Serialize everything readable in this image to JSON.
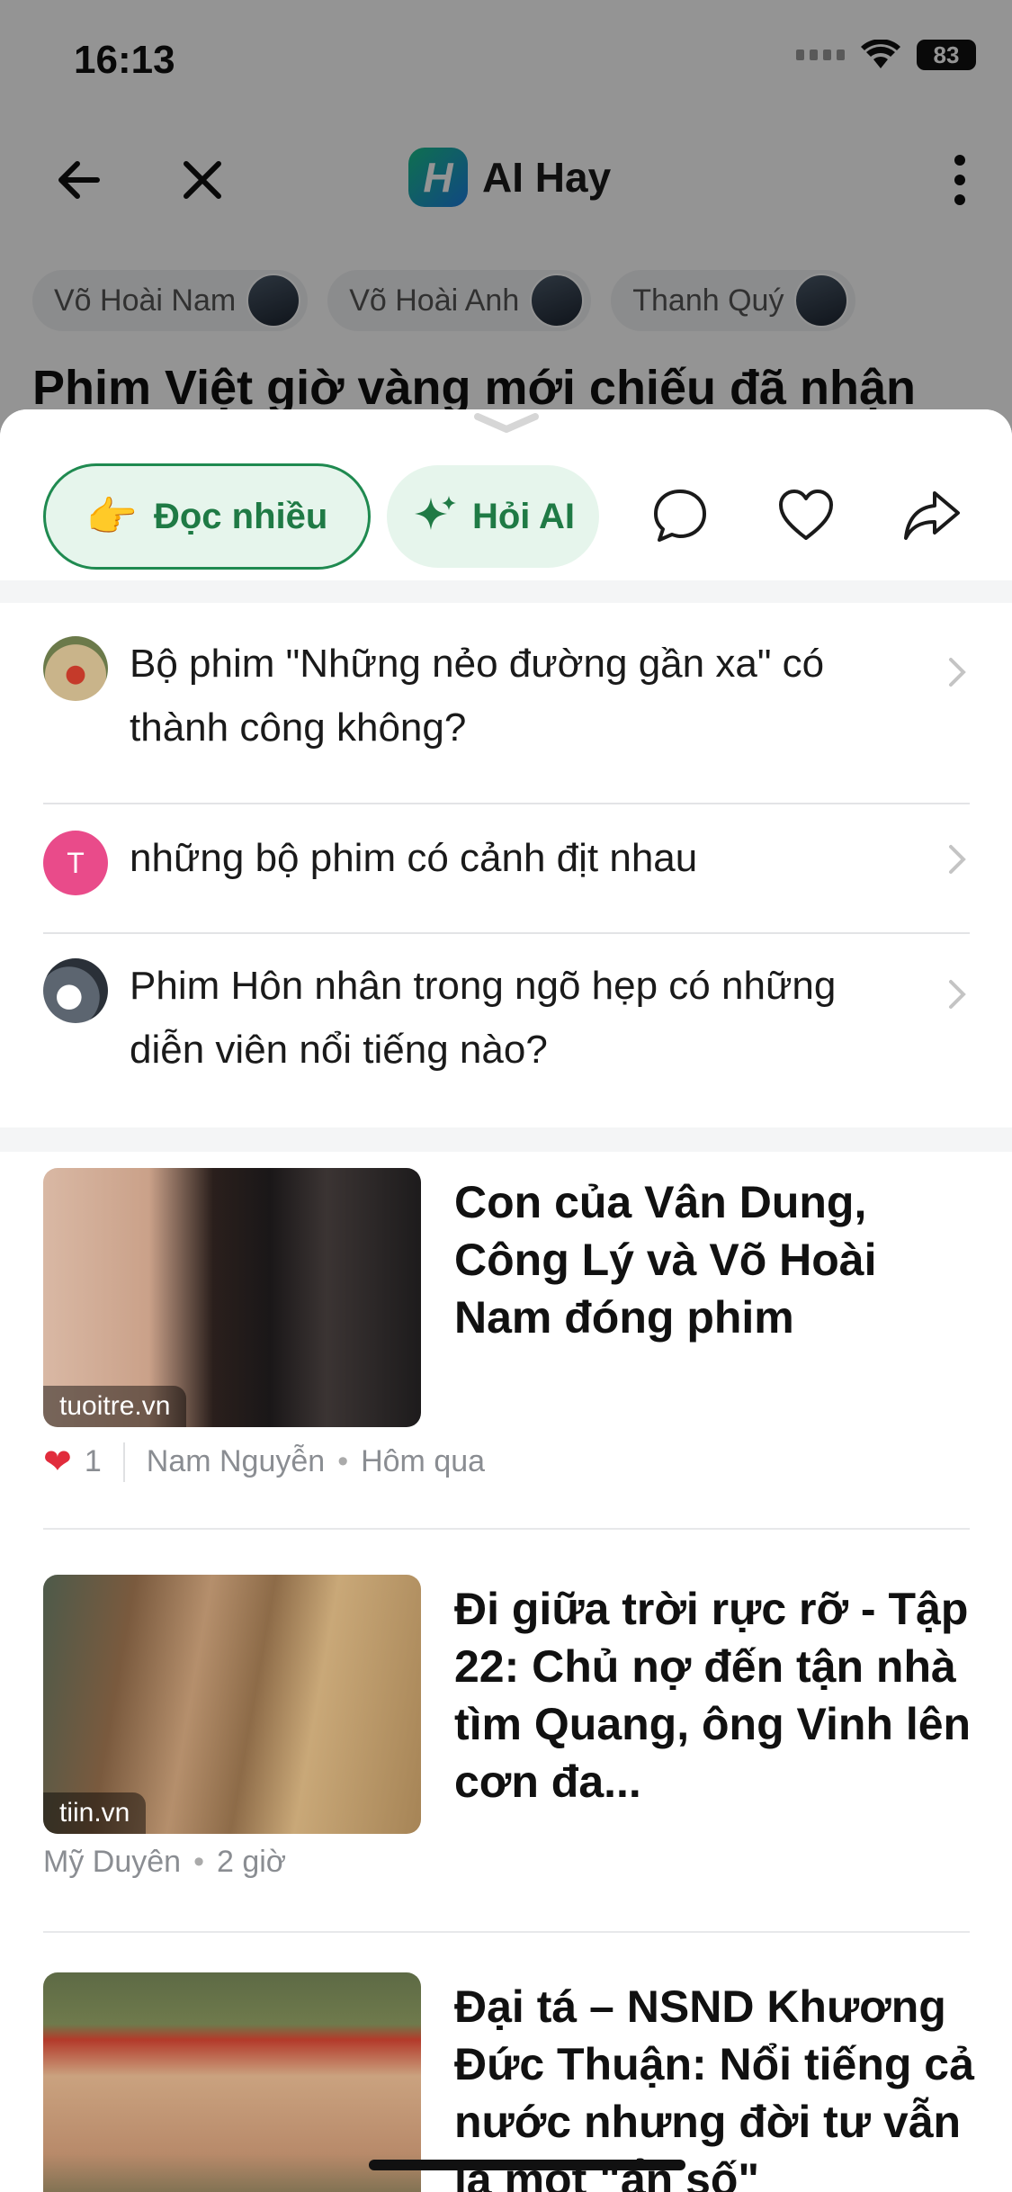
{
  "status": {
    "time": "16:13",
    "battery": "83"
  },
  "header": {
    "app_name": "AI Hay",
    "logo_letter": "H"
  },
  "people": [
    {
      "name": "Võ Hoài Nam"
    },
    {
      "name": "Võ Hoài Anh"
    },
    {
      "name": "Thanh Quý"
    }
  ],
  "article": {
    "title": "Phim Việt giờ vàng mới chiếu đã nhận"
  },
  "actions": {
    "doc_nhieu_label": "Đọc nhiều",
    "doc_nhieu_emoji": "👉",
    "hoi_ai_label": "Hỏi AI"
  },
  "questions": [
    {
      "text": "Bộ phim \"Những nẻo đường gần xa\" có thành công không?",
      "avatar": "photo"
    },
    {
      "text": "những bộ phim có cảnh địt nhau",
      "avatar": "T",
      "avatar_color": "#e94b8a"
    },
    {
      "text": "Phim Hôn nhân trong ngõ hẹp có những diễn viên nổi tiếng nào?",
      "avatar": "photo"
    }
  ],
  "news": [
    {
      "title": "Con của Vân Dung, Công Lý và Võ Hoài Nam đóng phim",
      "source": "tuoitre.vn",
      "likes": "1",
      "author": "Nam Nguyễn",
      "time": "Hôm qua"
    },
    {
      "title": "Đi giữa trời rực rỡ - Tập 22: Chủ nợ đến tận nhà tìm Quang, ông Vinh lên cơn đa...",
      "source": "tiin.vn",
      "author": "Mỹ Duyên",
      "time": "2 giờ"
    },
    {
      "title": "Đại tá – NSND Khương Đức Thuận: Nổi tiếng cả nước nhưng đời tư vẫn là một \"ẩn số\"",
      "source": ""
    }
  ],
  "colors": {
    "accent_green": "#1f7a45",
    "accent_bg": "#e6f5ec",
    "heart_red": "#e12c3c"
  }
}
